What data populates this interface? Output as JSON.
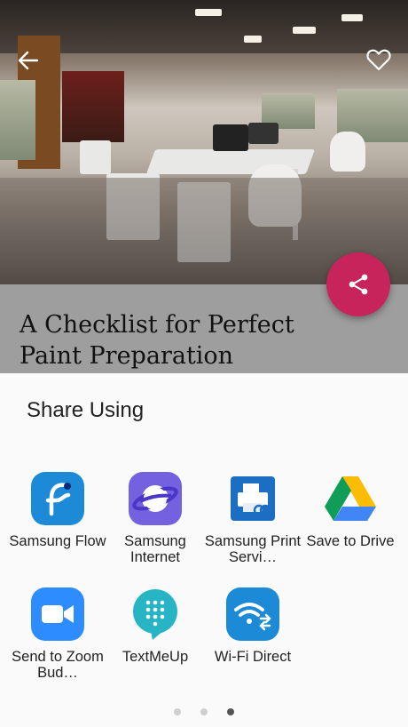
{
  "article": {
    "title": "A Checklist for Perfect Paint Preparation"
  },
  "share_sheet": {
    "title": "Share Using",
    "apps": [
      {
        "label": "Samsung Flow",
        "icon": "samsung-flow-icon"
      },
      {
        "label": "Samsung Internet",
        "icon": "samsung-internet-icon"
      },
      {
        "label": "Samsung Print Servi…",
        "icon": "samsung-print-service-icon"
      },
      {
        "label": "Save to Drive",
        "icon": "google-drive-icon"
      },
      {
        "label": "Send to Zoom Bud…",
        "icon": "zoom-icon"
      },
      {
        "label": "TextMeUp",
        "icon": "textmeup-icon"
      },
      {
        "label": "Wi-Fi Direct",
        "icon": "wifi-direct-icon"
      }
    ],
    "page_indicator": {
      "pages": 3,
      "active": 3
    }
  },
  "colors": {
    "fab": "#c8245c",
    "samsung_blue": "#1c8ad6",
    "internet_purple": "#7461e0",
    "zoom_blue": "#2d8cff",
    "textmeup_teal": "#27b5c6"
  }
}
